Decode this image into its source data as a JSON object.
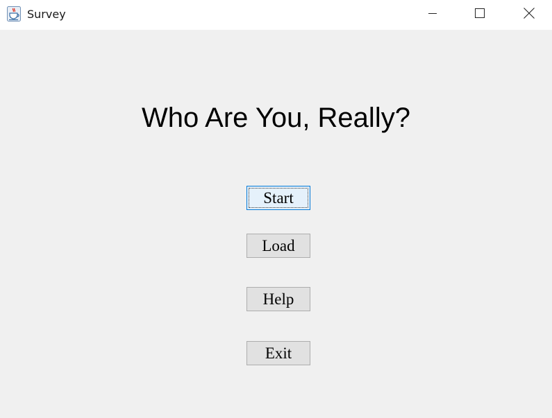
{
  "window": {
    "title": "Survey",
    "icon": "java-cup-icon",
    "controls": [
      "minimize-icon",
      "maximize-icon",
      "close-icon"
    ]
  },
  "main": {
    "headline": "Who Are You, Really?",
    "buttons": {
      "start": "Start",
      "load": "Load",
      "help": "Help",
      "exit": "Exit"
    },
    "focused_button": "start"
  },
  "colors": {
    "background": "#f0f0f0",
    "titlebar": "#ffffff",
    "button_face": "#e1e1e1",
    "button_border": "#adadad",
    "focus_border": "#0078d7"
  }
}
